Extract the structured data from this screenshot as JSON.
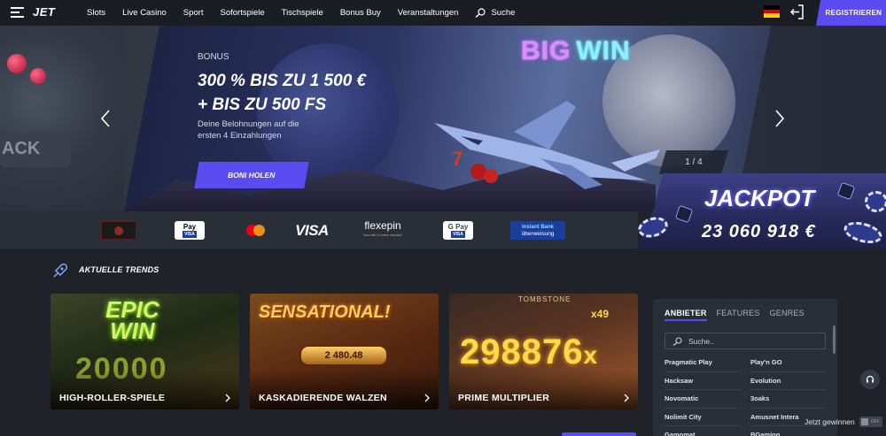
{
  "header": {
    "logo": "JET",
    "nav": [
      "Slots",
      "Live Casino",
      "Sport",
      "Sofortspiele",
      "Tischspiele",
      "Bonus Buy",
      "Veranstaltungen"
    ],
    "search_label": "Suche",
    "register_label": "REGISTRIEREN"
  },
  "hero": {
    "bonus_label": "BONUS",
    "title_line1": "300 % BIS ZU 1 500 €",
    "title_line2": "+ BIS ZU 500 FS",
    "description": "Deine Belohnungen auf die ersten 4 Einzahlungen",
    "cta_label": "BONI HOLEN",
    "big_label": "BIG",
    "win_label": "WIN",
    "slide_counter": "1 / 4",
    "left_deco_text": "ACK"
  },
  "payments": {
    "apple_pay": "Pay",
    "apple_card": "VISA",
    "visa": "VISA",
    "flexepin": "flexepin",
    "flexepin_sub": "Now with In-Game deposits!",
    "gpay": "G Pay",
    "gpay_card": "VISA",
    "instant_bank_1": "Instant Bank",
    "instant_bank_2": "überweisung"
  },
  "jackpot": {
    "label": "JACKPOT",
    "value": "23 060 918 €"
  },
  "trends": {
    "title": "AKTUELLE TRENDS",
    "cards": [
      {
        "label": "HIGH-ROLLER-SPIELE",
        "art_line1": "EPIC",
        "art_line2": "WIN",
        "art_value": "20000"
      },
      {
        "label": "KASKADIERENDE WALZEN",
        "art_line1": "SENSATIONAL!",
        "art_value": "2 480.48"
      },
      {
        "label": "PRIME MULTIPLIER",
        "art_line1": "TOMBSTONE",
        "art_value": "298876",
        "art_suffix": "x",
        "art_badge": "x49"
      }
    ]
  },
  "providers": {
    "tabs": [
      "ANBIETER",
      "FEATURES",
      "GENRES"
    ],
    "search_placeholder": "Suche..",
    "items": [
      "Pragmatic Play",
      "Play'n GO",
      "Hacksaw",
      "Evolution",
      "Novomatic",
      "3oaks",
      "Nolimit City",
      "Amusnet Intera",
      "Gamomat",
      "BGaming"
    ]
  },
  "footer": {
    "win_toggle_label": "Jetzt gewinnen",
    "toggle_state": "OFF"
  },
  "colors": {
    "accent": "#5a4cf0",
    "background": "#1f2229",
    "header": "#1a1d23"
  }
}
